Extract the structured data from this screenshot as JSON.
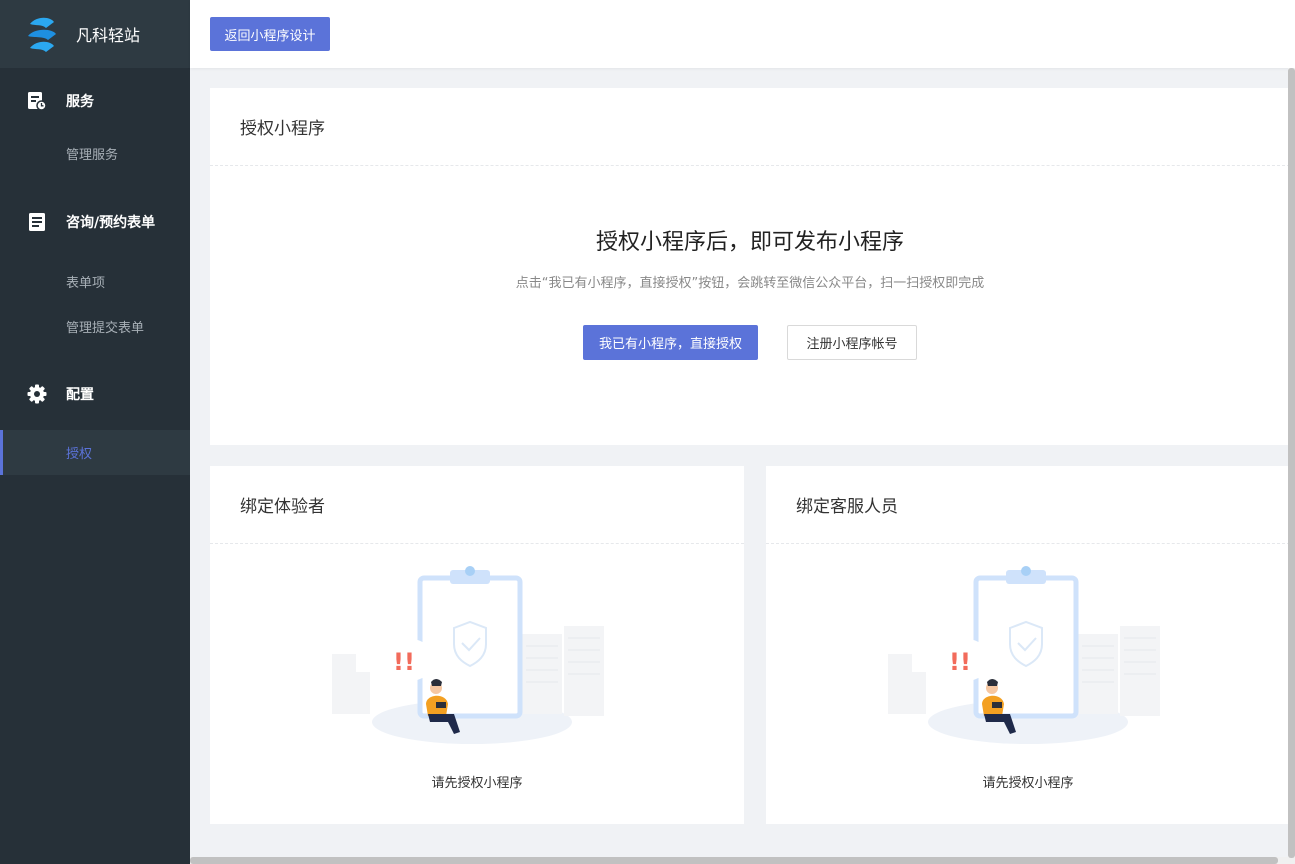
{
  "brand": {
    "name": "凡科轻站",
    "icon": "fanke-logo-icon"
  },
  "sidebar": {
    "groups": [
      {
        "label": "服务",
        "icon": "service-icon",
        "items": [
          {
            "label": "管理服务"
          }
        ]
      },
      {
        "label": "咨询/预约表单",
        "icon": "form-icon",
        "items": [
          {
            "label": "表单项"
          },
          {
            "label": "管理提交表单"
          }
        ]
      },
      {
        "label": "配置",
        "icon": "gear-icon",
        "items": [
          {
            "label": "授权",
            "active": true
          }
        ]
      }
    ]
  },
  "topbar": {
    "back_label": "返回小程序设计"
  },
  "auth": {
    "title": "授权小程序",
    "headline": "授权小程序后，即可发布小程序",
    "description": "点击“我已有小程序，直接授权”按钮，会跳转至微信公众平台，扫一扫授权即完成",
    "authorize_label": "我已有小程序，直接授权",
    "register_label": "注册小程序帐号"
  },
  "bind_testers": {
    "title": "绑定体验者",
    "empty_text": "请先授权小程序"
  },
  "bind_service": {
    "title": "绑定客服人员",
    "empty_text": "请先授权小程序"
  },
  "colors": {
    "accent": "#5b73d9",
    "sidebar_bg": "#263038",
    "alert": "#f26b5b"
  }
}
